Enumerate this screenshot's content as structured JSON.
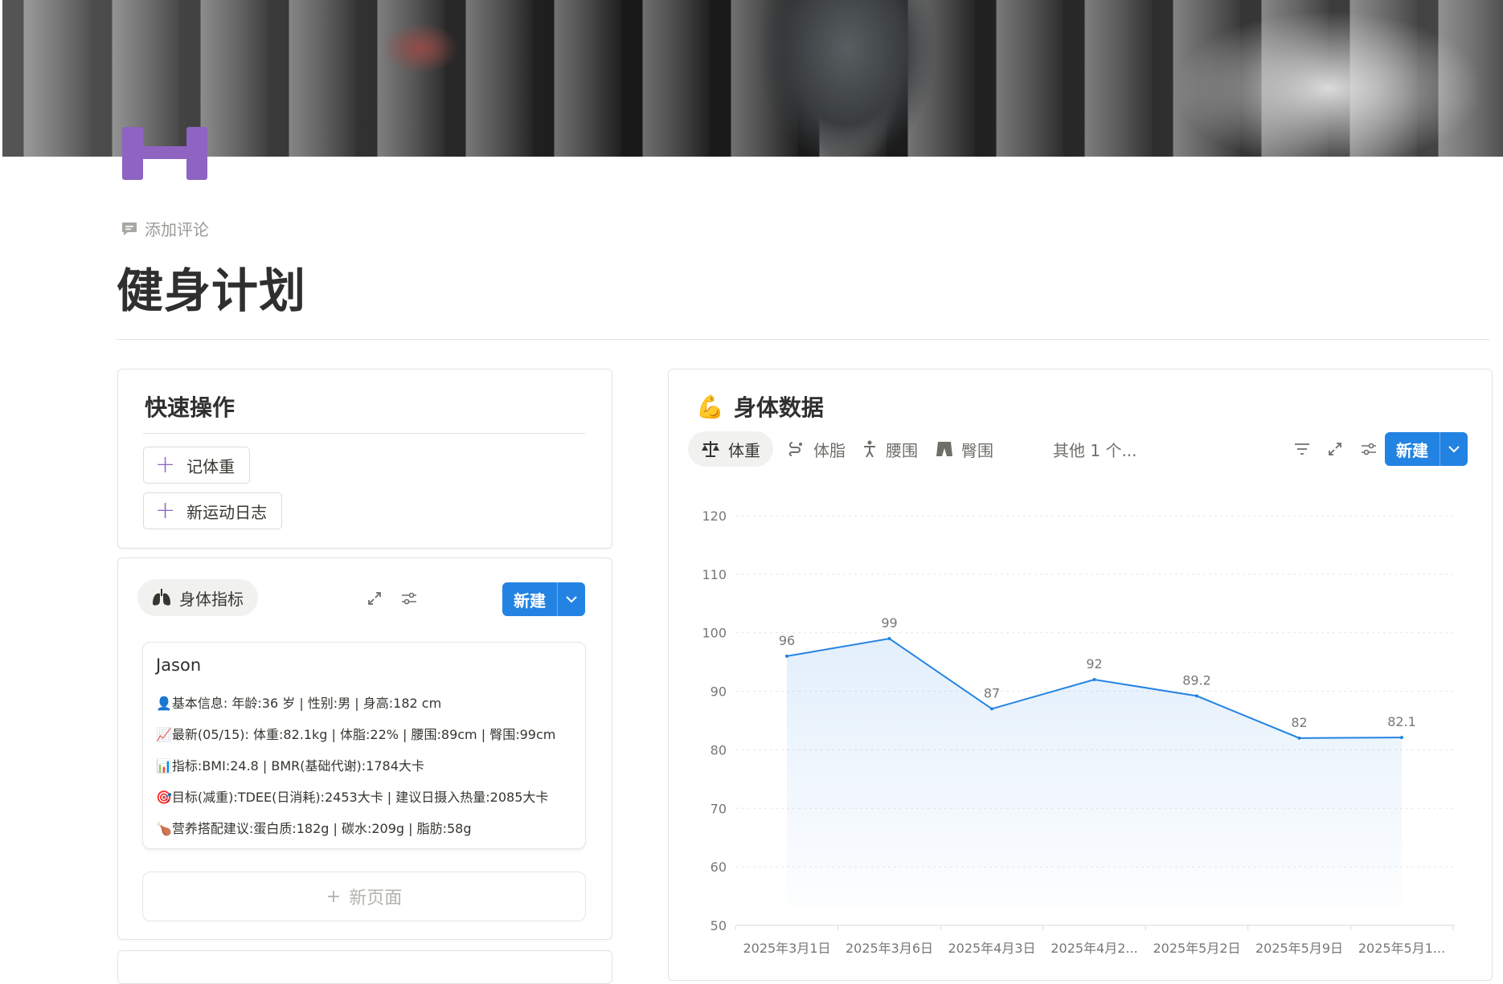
{
  "page": {
    "add_comment": "添加评论",
    "title": "健身计划"
  },
  "quick_actions": {
    "title": "快速操作",
    "buttons": [
      "记体重",
      "新运动日志"
    ]
  },
  "body_metrics": {
    "chip_label": "身体指标",
    "new_label": "新建",
    "card": {
      "name": "Jason",
      "lines": [
        "👤基本信息: 年龄:36 岁 | 性别:男 | 身高:182 cm",
        "📈最新(05/15): 体重:82.1kg | 体脂:22% | 腰围:89cm | 臀围:99cm",
        "📊指标:BMI:24.8 | BMR(基础代谢):1784大卡",
        "🎯目标(减重):TDEE(日消耗):2453大卡 | 建议日摄入热量:2085大卡",
        "🍗营养搭配建议:蛋白质:182g | 碳水:209g | 脂肪:58g"
      ]
    },
    "new_page": "新页面"
  },
  "body_data": {
    "title": "身体数据",
    "title_emoji": "💪",
    "tabs": [
      {
        "label": "体重",
        "icon": "scale-icon"
      },
      {
        "label": "体脂",
        "icon": "body-fat-icon"
      },
      {
        "label": "腰围",
        "icon": "person-icon"
      },
      {
        "label": "臀围",
        "icon": "shorts-icon"
      },
      {
        "label": "其他 1 个...",
        "icon": ""
      }
    ],
    "new_label": "新建"
  },
  "colors": {
    "accent_blue": "#2383e2",
    "icon_purple": "#8e63c2",
    "line_blue": "#2383e2"
  },
  "chart_data": {
    "type": "line",
    "categories": [
      "2025年3月1日",
      "2025年3月6日",
      "2025年4月3日",
      "2025年4月2...",
      "2025年5月2日",
      "2025年5月9日",
      "2025年5月1..."
    ],
    "values": [
      96,
      99,
      87,
      92,
      89.2,
      82,
      82.1
    ],
    "ylim": [
      50,
      120
    ],
    "yticks": [
      50,
      60,
      70,
      80,
      90,
      100,
      110,
      120
    ],
    "grid": true,
    "area_fill": true
  }
}
